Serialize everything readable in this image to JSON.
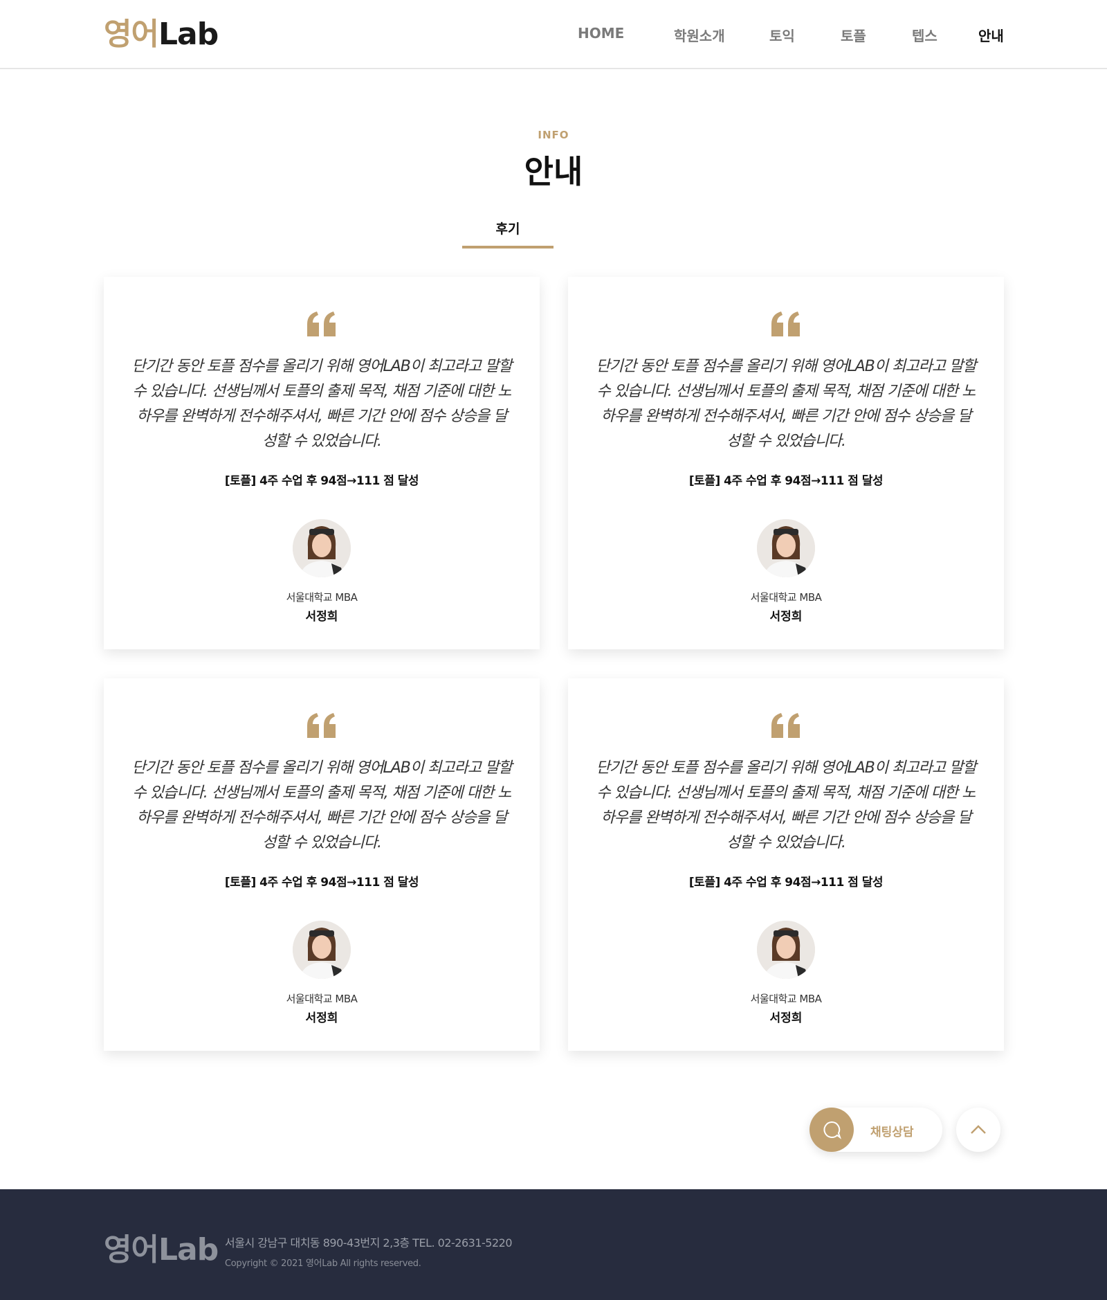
{
  "header": {
    "logo_kr": "영어",
    "logo_en": "Lab",
    "nav": [
      "HOME",
      "학원소개",
      "토익",
      "토플",
      "텝스",
      "안내"
    ],
    "active_nav": "안내"
  },
  "section": {
    "subtitle": "INFO",
    "title": "안내",
    "tab": "후기"
  },
  "reviews": [
    {
      "text": "단기간 동안 토플 점수를 올리기 위해 영어LAB이 최고라고 말할 수 있습니다. 선생님께서 토플의 출제 목적, 채점 기준에 대한 노하우를 완벽하게 전수해주셔서, 빠른 기간 안에 점수 상승을 달성할 수 있었습니다.",
      "result": "[토플] 4주 수업 후 94점→111 점 달성",
      "school": "서울대학교 MBA",
      "name": "서정희"
    },
    {
      "text": "단기간 동안 토플 점수를 올리기 위해 영어LAB이 최고라고 말할 수 있습니다. 선생님께서 토플의 출제 목적, 채점 기준에 대한 노하우를 완벽하게 전수해주셔서, 빠른 기간 안에 점수 상승을 달성할 수 있었습니다.",
      "result": "[토플] 4주 수업 후 94점→111 점 달성",
      "school": "서울대학교 MBA",
      "name": "서정희"
    },
    {
      "text": "단기간 동안 토플 점수를 올리기 위해 영어LAB이 최고라고 말할 수 있습니다. 선생님께서 토플의 출제 목적, 채점 기준에 대한 노하우를 완벽하게 전수해주셔서, 빠른 기간 안에 점수 상승을 달성할 수 있었습니다.",
      "result": "[토플] 4주 수업 후 94점→111 점 달성",
      "school": "서울대학교 MBA",
      "name": "서정희"
    },
    {
      "text": "단기간 동안 토플 점수를 올리기 위해 영어LAB이 최고라고 말할 수 있습니다. 선생님께서 토플의 출제 목적, 채점 기준에 대한 노하우를 완벽하게 전수해주셔서, 빠른 기간 안에 점수 상승을 달성할 수 있었습니다.",
      "result": "[토플] 4주 수업 후 94점→111 점 달성",
      "school": "서울대학교 MBA",
      "name": "서정희"
    }
  ],
  "floating": {
    "chat_label": "채팅상담",
    "chat_icon": "chat-bubble-icon",
    "top_icon": "chevron-up-icon"
  },
  "footer": {
    "logo": "영어Lab",
    "address": "서울시 강남구 대치동 890-43번지 2,3층 TEL. 02-2631-5220",
    "copyright": "Copyright © 2021 영어Lab All rights reserved."
  },
  "colors": {
    "accent": "#c0a070",
    "footer_bg": "#272c3e",
    "text_dark": "#111111"
  }
}
